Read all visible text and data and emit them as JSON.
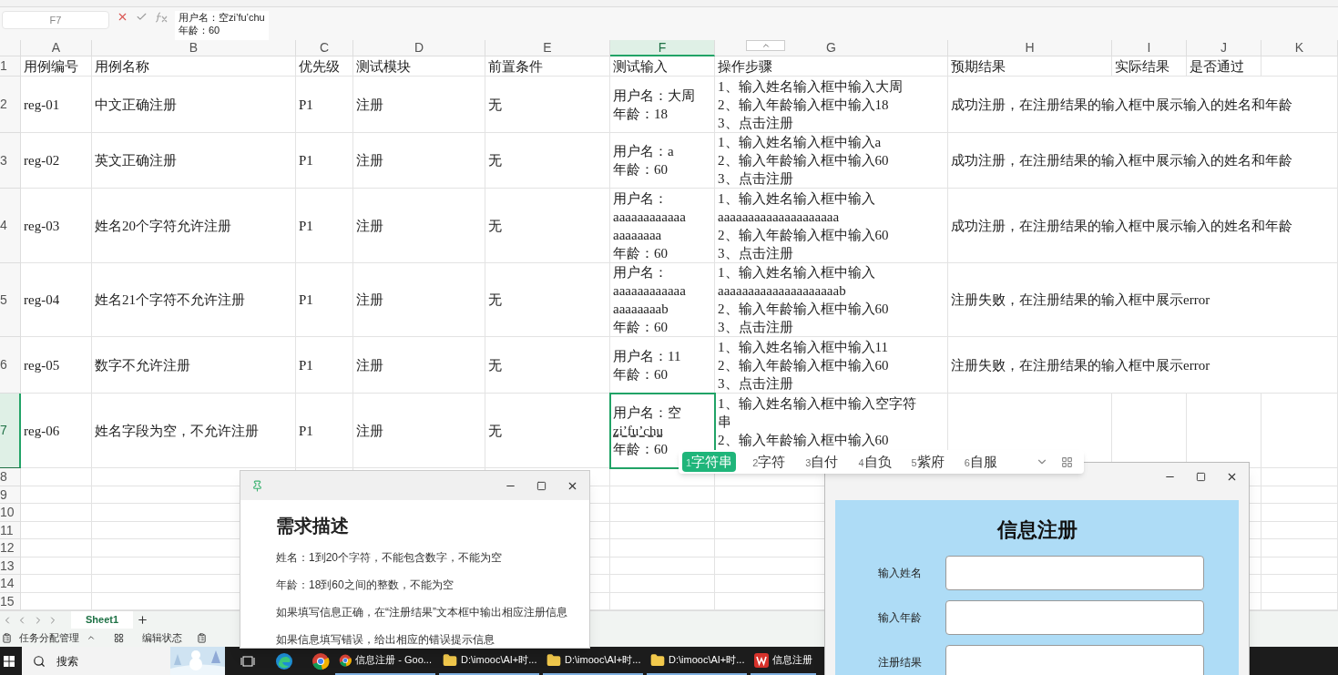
{
  "formula_bar": {
    "cell_ref": "F7",
    "lines": [
      "用户名：空zi’fu’chu",
      "年龄：60"
    ]
  },
  "columns": [
    {
      "label": "A",
      "selected": false
    },
    {
      "label": "B",
      "selected": false
    },
    {
      "label": "C",
      "selected": false
    },
    {
      "label": "D",
      "selected": false
    },
    {
      "label": "E",
      "selected": false
    },
    {
      "label": "F",
      "selected": true
    },
    {
      "label": "G",
      "selected": false
    },
    {
      "label": "H",
      "selected": false
    },
    {
      "label": "I",
      "selected": false
    },
    {
      "label": "J",
      "selected": false
    },
    {
      "label": "K",
      "selected": false
    }
  ],
  "rows": [
    {
      "number": "1",
      "selected": false,
      "cells": [
        [
          "用例编号"
        ],
        [
          "用例名称"
        ],
        [
          "优先级"
        ],
        [
          "测试模块"
        ],
        [
          "前置条件"
        ],
        [
          "测试输入"
        ],
        [
          "操作步骤"
        ],
        [
          "预期结果"
        ],
        [
          "实际结果"
        ],
        [
          "是否通过"
        ],
        []
      ]
    },
    {
      "number": "2",
      "selected": false,
      "cells": [
        [
          "reg-01"
        ],
        [
          "中文正确注册"
        ],
        [
          "P1"
        ],
        [
          "注册"
        ],
        [
          "无"
        ],
        [
          "用户名：大周",
          "年龄：18"
        ],
        [
          "1、输入姓名输入框中输入大周",
          "2、输入年龄输入框中输入18",
          "3、点击注册"
        ],
        [
          "成功注册，在注册结果的输入框中展示输入的姓名和年龄"
        ],
        [],
        [],
        []
      ]
    },
    {
      "number": "3",
      "selected": false,
      "cells": [
        [
          "reg-02"
        ],
        [
          "英文正确注册"
        ],
        [
          "P1"
        ],
        [
          "注册"
        ],
        [
          "无"
        ],
        [
          "用户名：a",
          "年龄：60"
        ],
        [
          "1、输入姓名输入框中输入a",
          "2、输入年龄输入框中输入60",
          "3、点击注册"
        ],
        [
          "成功注册，在注册结果的输入框中展示输入的姓名和年龄"
        ],
        [],
        [],
        []
      ]
    },
    {
      "number": "4",
      "selected": false,
      "cells": [
        [
          "reg-03"
        ],
        [
          "姓名20个字符允许注册"
        ],
        [
          "P1"
        ],
        [
          "注册"
        ],
        [
          "无"
        ],
        [
          "用户名：",
          "aaaaaaaaaaaa",
          "aaaaaaaa",
          "年龄：60"
        ],
        [
          "1、输入姓名输入框中输入",
          "aaaaaaaaaaaaaaaaaaaa",
          "2、输入年龄输入框中输入60",
          "3、点击注册"
        ],
        [
          "成功注册，在注册结果的输入框中展示输入的姓名和年龄"
        ],
        [],
        [],
        []
      ]
    },
    {
      "number": "5",
      "selected": false,
      "cells": [
        [
          "reg-04"
        ],
        [
          "姓名21个字符不允许注册"
        ],
        [
          "P1"
        ],
        [
          "注册"
        ],
        [
          "无"
        ],
        [
          "用户名：",
          "aaaaaaaaaaaa",
          "aaaaaaaab",
          "年龄：60"
        ],
        [
          "1、输入姓名输入框中输入",
          "aaaaaaaaaaaaaaaaaaaab",
          "2、输入年龄输入框中输入60",
          "3、点击注册"
        ],
        [
          "注册失败，在注册结果的输入框中展示error"
        ],
        [],
        [],
        []
      ]
    },
    {
      "number": "6",
      "selected": false,
      "cells": [
        [
          "reg-05"
        ],
        [
          "数字不允许注册"
        ],
        [
          "P1"
        ],
        [
          "注册"
        ],
        [
          "无"
        ],
        [
          "用户名：11",
          "年龄：60"
        ],
        [
          "1、输入姓名输入框中输入11",
          "2、输入年龄输入框中输入60",
          "3、点击注册"
        ],
        [
          "注册失败，在注册结果的输入框中展示error"
        ],
        [],
        [],
        []
      ]
    },
    {
      "number": "7",
      "selected": true,
      "cells": [
        [
          "reg-06"
        ],
        [
          "姓名字段为空，不允许注册"
        ],
        [
          "P1"
        ],
        [
          "注册"
        ],
        [
          "无"
        ],
        [
          "用户名：空",
          "zi’fu’chu",
          "年龄：60"
        ],
        [
          "1、输入姓名输入框中输入空字符",
          "串",
          "2、输入年龄输入框中输入60"
        ],
        [],
        [],
        [],
        []
      ]
    }
  ],
  "empty_rows": [
    "8",
    "9",
    "10",
    "11",
    "12",
    "13",
    "14",
    "15"
  ],
  "sheet_tabs": [
    {
      "label": "Sheet1",
      "selected": true
    }
  ],
  "status_bar": [
    "任务分配管理",
    "编辑状态"
  ],
  "ime": {
    "candidates": [
      {
        "index": "1",
        "text": "字符串",
        "selected": true
      },
      {
        "index": "2",
        "text": "字符",
        "selected": false
      },
      {
        "index": "3",
        "text": "自付",
        "selected": false
      },
      {
        "index": "4",
        "text": "自负",
        "selected": false
      },
      {
        "index": "5",
        "text": "紫府",
        "selected": false
      },
      {
        "index": "6",
        "text": "自服",
        "selected": false
      }
    ]
  },
  "requirements_window": {
    "heading": "需求描述",
    "lines": [
      "姓名：1到20个字符，不能包含数字，不能为空",
      "年龄：18到60之间的整数，不能为空",
      "如果填写信息正确，在“注册结果”文本框中输出相应注册信息",
      "如果信息填写错误，给出相应的错误提示信息"
    ]
  },
  "register_window": {
    "title": "信息注册",
    "fields": [
      "输入姓名",
      "输入年龄",
      "注册结果"
    ]
  },
  "taskbar": {
    "search": "搜索",
    "items": [
      {
        "kind": "chrome",
        "label": "信息注册 - Goo..."
      },
      {
        "kind": "folder",
        "label": "D:\\imooc\\AI+时..."
      },
      {
        "kind": "folder",
        "label": "D:\\imooc\\AI+时..."
      },
      {
        "kind": "folder",
        "label": "D:\\imooc\\AI+时..."
      },
      {
        "kind": "wps",
        "label": "信息注册"
      }
    ]
  }
}
